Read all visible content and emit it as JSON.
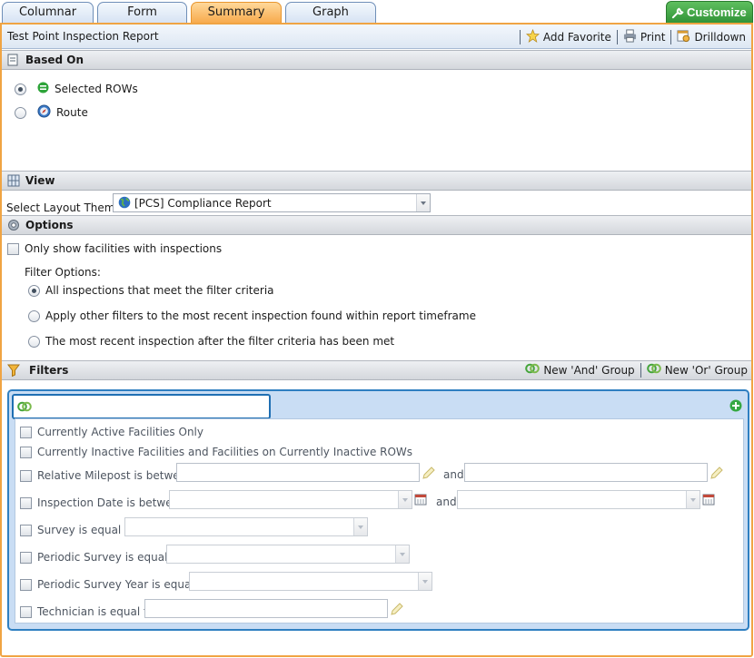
{
  "tabs": [
    "Columnar",
    "Form",
    "Summary",
    "Graph"
  ],
  "active_tab": "Summary",
  "customize_label": "Customize",
  "report_title": "Test Point Inspection Report",
  "toolbar": {
    "add_favorite": "Add Favorite",
    "print": "Print",
    "drilldown": "Drilldown"
  },
  "based_on": {
    "header": "Based On",
    "options": [
      {
        "label": "Selected ROWs",
        "checked": true
      },
      {
        "label": "Route",
        "checked": false
      }
    ]
  },
  "view": {
    "header": "View",
    "theme_label": "Select Layout Theme",
    "theme_value": "[PCS] Compliance Report"
  },
  "options": {
    "header": "Options",
    "only_show_label": "Only show facilities with inspections",
    "filter_options_label": "Filter Options:",
    "filter_radios": [
      {
        "label": "All inspections that meet the filter criteria",
        "checked": true
      },
      {
        "label": "Apply other filters to the most recent inspection found within report timeframe",
        "checked": false
      },
      {
        "label": "The most recent inspection after the filter criteria has been met",
        "checked": false
      }
    ]
  },
  "filters": {
    "header": "Filters",
    "new_and_group": "New 'And' Group",
    "new_or_group": "New 'Or' Group",
    "group_name_value": "",
    "rows": {
      "active": "Currently Active Facilities Only",
      "inactive": "Currently Inactive Facilities and Facilities on Currently Inactive ROWs",
      "milepost": "Relative Milepost is between",
      "inspection_date": "Inspection Date is between",
      "survey": "Survey is equal to",
      "periodic_survey": "Periodic Survey is equal to",
      "periodic_survey_year": "Periodic Survey Year is equal to",
      "technician": "Technician is equal to"
    },
    "and_label": "and"
  },
  "colors": {
    "accent_orange": "#f0a443",
    "customize_green": "#2f9236",
    "filter_blue": "#2f7fc1"
  }
}
